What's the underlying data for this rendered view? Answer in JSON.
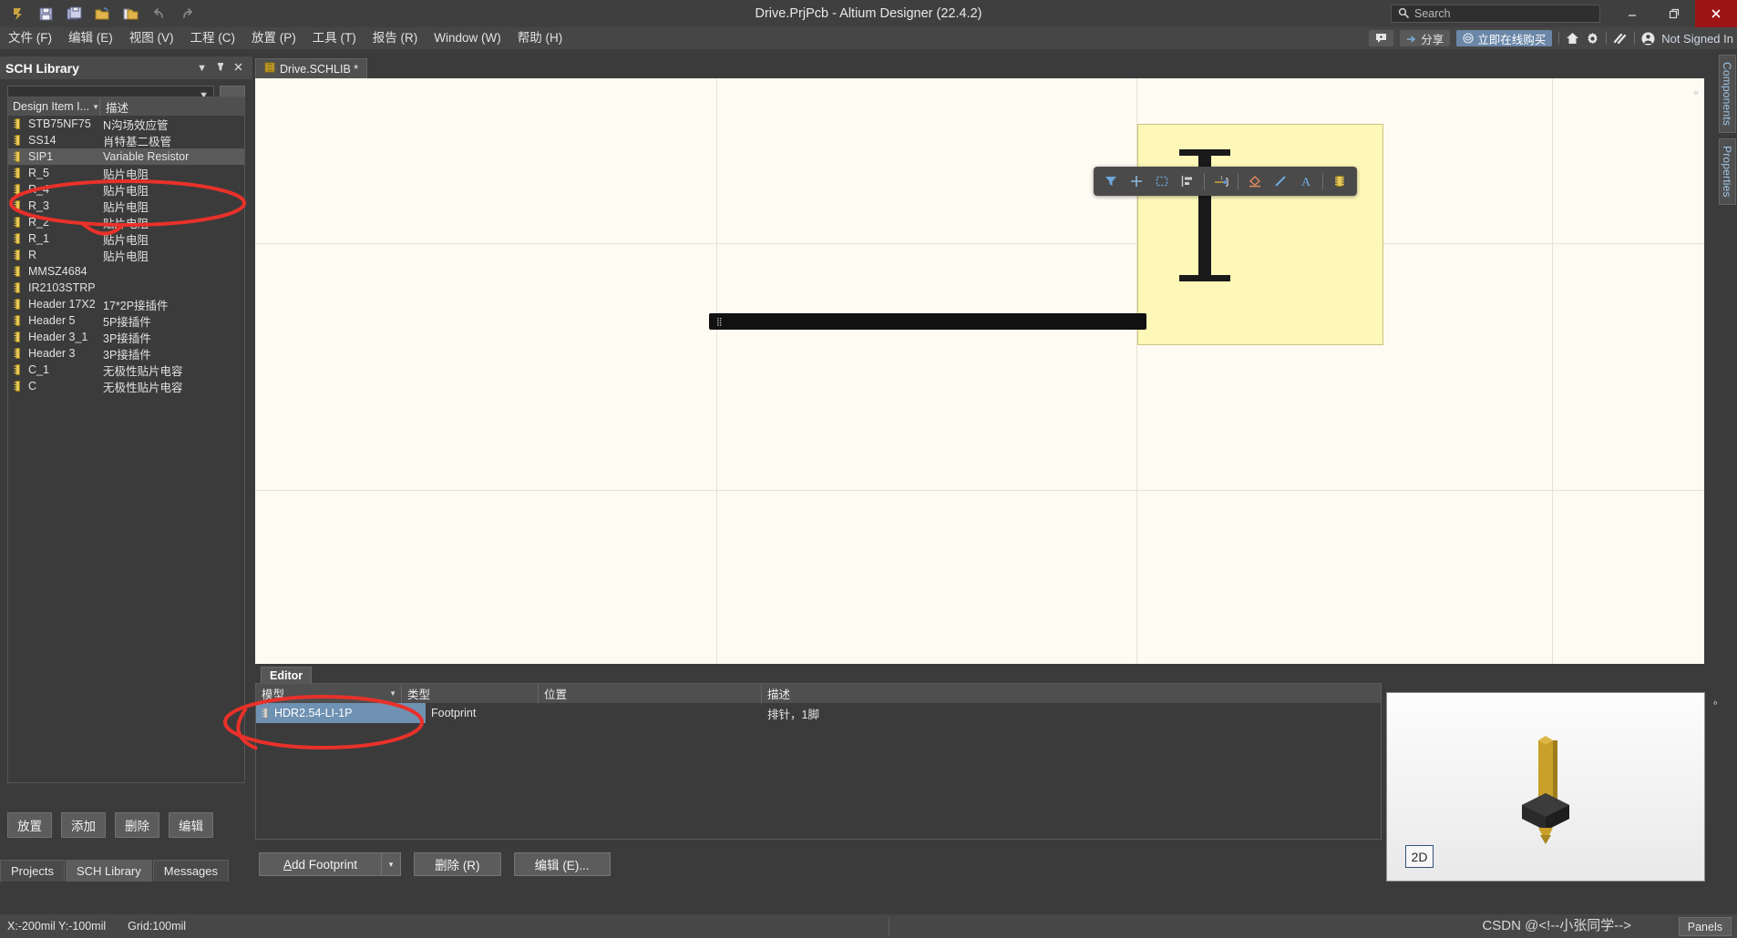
{
  "window": {
    "title": "Drive.PrjPcb - Altium Designer (22.4.2)",
    "search_placeholder": "Search",
    "minimize": "—",
    "restore": "❐",
    "close": "✕"
  },
  "quick_access": [
    {
      "name": "altium-logo-icon",
      "label": "A"
    },
    {
      "name": "save-icon",
      "label": "Save"
    },
    {
      "name": "save-all-icon",
      "label": "Save All"
    },
    {
      "name": "open-icon",
      "label": "Open"
    },
    {
      "name": "open-project-icon",
      "label": "Open Project"
    },
    {
      "name": "undo-icon",
      "label": "Undo"
    },
    {
      "name": "redo-icon",
      "label": "Redo"
    }
  ],
  "menu": [
    {
      "label": "文件 (F)"
    },
    {
      "label": "编辑 (E)"
    },
    {
      "label": "视图 (V)"
    },
    {
      "label": "工程 (C)"
    },
    {
      "label": "放置 (P)"
    },
    {
      "label": "工具 (T)"
    },
    {
      "label": "报告 (R)"
    },
    {
      "label": "Window (W)"
    },
    {
      "label": "帮助 (H)"
    }
  ],
  "menu_right": {
    "comment_label": "",
    "share_label": "分享",
    "buy_label": "立即在线购买",
    "home_icon": "home-icon",
    "settings_icon": "gear-icon",
    "extensions_icon": "extensions-icon",
    "account_label": "Not Signed In"
  },
  "sch_library": {
    "panel_title": "SCH Library",
    "filter_value": "",
    "more_button": "...",
    "columns": [
      "Design Item I...",
      "描述"
    ],
    "rows": [
      {
        "name": "STB75NF75",
        "desc": "N沟场效应管",
        "selected": false
      },
      {
        "name": "SS14",
        "desc": "肖特基二极管",
        "selected": false
      },
      {
        "name": "SIP1",
        "desc": "Variable Resistor",
        "selected": true
      },
      {
        "name": "R_5",
        "desc": "贴片电阻",
        "selected": false
      },
      {
        "name": "R_4",
        "desc": "贴片电阻",
        "selected": false
      },
      {
        "name": "R_3",
        "desc": "贴片电阻",
        "selected": false
      },
      {
        "name": "R_2",
        "desc": "贴片电阻",
        "selected": false
      },
      {
        "name": "R_1",
        "desc": "贴片电阻",
        "selected": false
      },
      {
        "name": "R",
        "desc": "贴片电阻",
        "selected": false
      },
      {
        "name": "MMSZ4684",
        "desc": "",
        "selected": false
      },
      {
        "name": "IR2103STRP",
        "desc": "",
        "selected": false
      },
      {
        "name": "Header 17X2",
        "desc": "17*2P接插件",
        "selected": false
      },
      {
        "name": "Header 5",
        "desc": "5P接插件",
        "selected": false
      },
      {
        "name": "Header 3_1",
        "desc": "3P接插件",
        "selected": false
      },
      {
        "name": "Header 3",
        "desc": "3P接插件",
        "selected": false
      },
      {
        "name": "C_1",
        "desc": "无极性贴片电容",
        "selected": false
      },
      {
        "name": "C",
        "desc": "无极性贴片电容",
        "selected": false
      }
    ],
    "buttons": [
      "放置",
      "添加",
      "删除",
      "编辑"
    ]
  },
  "bottom_tabs": [
    {
      "label": "Projects",
      "active": false
    },
    {
      "label": "SCH Library",
      "active": true
    },
    {
      "label": "Messages",
      "active": false
    }
  ],
  "document_tabs": [
    {
      "label": "Drive.SCHLIB *",
      "icon": "schlib-icon"
    }
  ],
  "canvas_toolbar": [
    {
      "name": "filter-icon"
    },
    {
      "name": "crosshair-icon"
    },
    {
      "name": "select-area-icon"
    },
    {
      "name": "align-icon"
    },
    {
      "name": "place-pin-icon"
    },
    {
      "name": "place-polygon-icon"
    },
    {
      "name": "place-line-icon"
    },
    {
      "name": "place-text-icon"
    },
    {
      "name": "place-component-icon"
    }
  ],
  "editor": {
    "tab_label": "Editor",
    "columns": [
      "模型",
      "类型",
      "位置",
      "描述"
    ],
    "rows": [
      {
        "model": "HDR2.54-LI-1P",
        "type": "Footprint",
        "location": "",
        "description": "排针，1脚"
      }
    ],
    "buttons": {
      "add_footprint": "Add Footprint",
      "add_footprint_arrow": "▾",
      "delete": "删除 (R)",
      "edit": "编辑 (E)..."
    }
  },
  "preview": {
    "mode_badge": "2D"
  },
  "right_dock": [
    {
      "label": "Components"
    },
    {
      "label": "Properties"
    }
  ],
  "status": {
    "coords": "X:-200mil Y:-100mil",
    "grid": "Grid:100mil",
    "watermark": "CSDN @<!--小张同学-->",
    "panels_button": "Panels"
  },
  "colors": {
    "accent_blue": "#6f91b2",
    "canvas_bg": "#fdfbf2",
    "annotation_red": "#e8312a",
    "yellow_fill": "#fdf8b8",
    "pin_gold": "#c8a02a"
  }
}
